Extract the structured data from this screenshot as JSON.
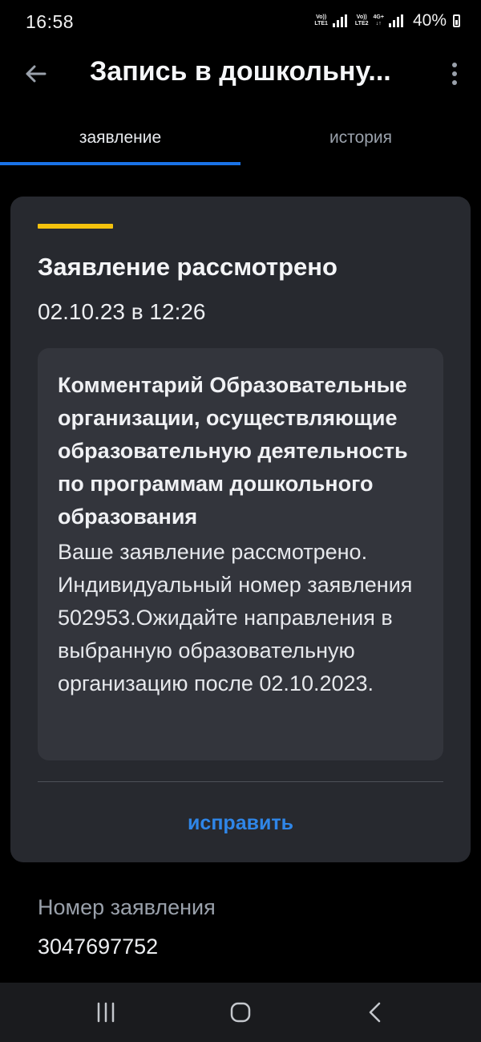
{
  "status_bar": {
    "time": "16:58",
    "sim1_line1": "Vo))",
    "sim1_line2": "LTE1",
    "sim2_line1": "Vo))",
    "sim2_line2": "LTE2",
    "network": "4G+",
    "battery": "40%"
  },
  "app_bar": {
    "title": "Запись в дошкольну..."
  },
  "tabs": [
    {
      "label": "заявление",
      "active": true
    },
    {
      "label": "история",
      "active": false
    }
  ],
  "card": {
    "status_title": "Заявление рассмотрено",
    "date": "02.10.23 в 12:26",
    "comment_title": "Комментарий Образовательные организации, осуществляющие образовательную деятельность по программам дошкольного образования",
    "comment_body": "Ваше заявление рассмотрено. Индивидуальный номер заявления 502953.Ожидайте направления в выбранную образовательную организацию после 02.10.2023.",
    "fix_label": "исправить"
  },
  "application_number": {
    "label": "Номер заявления",
    "value": "3047697752"
  },
  "colors": {
    "accent_blue": "#1a73e8",
    "status_yellow": "#f4c20d",
    "card_bg": "#27292f"
  }
}
